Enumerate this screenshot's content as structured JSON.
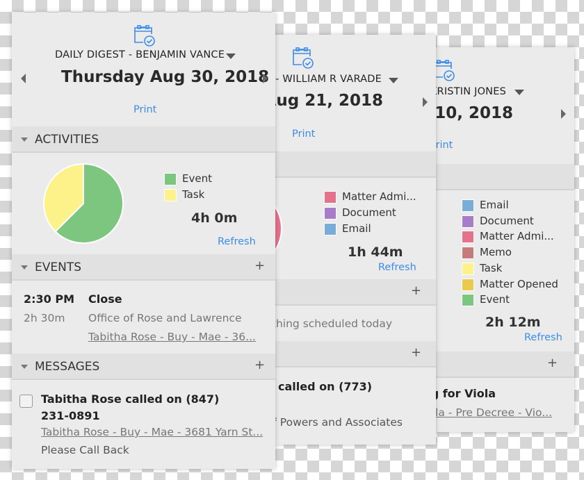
{
  "colors": {
    "accent": "#3c8ce7",
    "event": "#7dc67f",
    "task": "#fdf28a",
    "matter_admin": "#e5728d",
    "document": "#a97cc9",
    "email": "#78acd9",
    "memo": "#c77a7a",
    "matter_opened": "#ebc94d"
  },
  "back_panel": {
    "title": "DAILY DIGEST - KRISTIN JONES",
    "date": "Friday Aug 10, 2018",
    "print": "Print",
    "legend": [
      {
        "label": "Email",
        "color": "#78acd9"
      },
      {
        "label": "Document",
        "color": "#a97cc9"
      },
      {
        "label": "Matter Admi...",
        "color": "#e5728d"
      },
      {
        "label": "Memo",
        "color": "#c77a7a"
      },
      {
        "label": "Task",
        "color": "#fdf28a"
      },
      {
        "label": "Matter Opened",
        "color": "#ebc94d"
      },
      {
        "label": "Event",
        "color": "#7dc67f"
      }
    ],
    "total": "2h 12m",
    "refresh": "Refresh",
    "add": "+",
    "message_title": "Meeting for Viola",
    "message_link": "Viola - Pre Decree - Vio..."
  },
  "middle_panel": {
    "title": "DAILY DIGEST - WILLIAM R VARADE",
    "date": "Tuesday Aug 21, 2018",
    "print": "Print",
    "legend": [
      {
        "label": "Matter Admi...",
        "color": "#e5728d"
      },
      {
        "label": "Document",
        "color": "#a97cc9"
      },
      {
        "label": "Email",
        "color": "#78acd9"
      }
    ],
    "total": "1h 44m",
    "refresh": "Refresh",
    "add": "+",
    "no_events": "Nothing scheduled today",
    "message_title": "called on (773)",
    "message_sub": "Office of Powers and Associates"
  },
  "front_panel": {
    "title": "DAILY DIGEST - BENJAMIN VANCE",
    "date": "Thursday Aug 30, 2018",
    "print": "Print",
    "activities_label": "ACTIVITIES",
    "events_label": "EVENTS",
    "messages_label": "MESSAGES",
    "add": "+",
    "legend": [
      {
        "label": "Event",
        "color": "#7dc67f"
      },
      {
        "label": "Task",
        "color": "#fdf28a"
      }
    ],
    "pie": [
      {
        "label": "Event",
        "value": 62.5,
        "color": "#7dc67f"
      },
      {
        "label": "Task",
        "value": 37.5,
        "color": "#fdf28a"
      }
    ],
    "total": "4h 0m",
    "refresh": "Refresh",
    "event": {
      "time": "2:30 PM",
      "duration": "2h 30m",
      "title": "Close",
      "location": "Office of Rose and Lawrence",
      "link": "Tabitha Rose - Buy - Mae - 36..."
    },
    "message": {
      "title_line1": "Tabitha Rose called on (847)",
      "title_line2": "231-0891",
      "link": "Tabitha Rose - Buy - Mae - 3681 Yarn St...",
      "note": "Please Call Back",
      "checked": false
    }
  }
}
